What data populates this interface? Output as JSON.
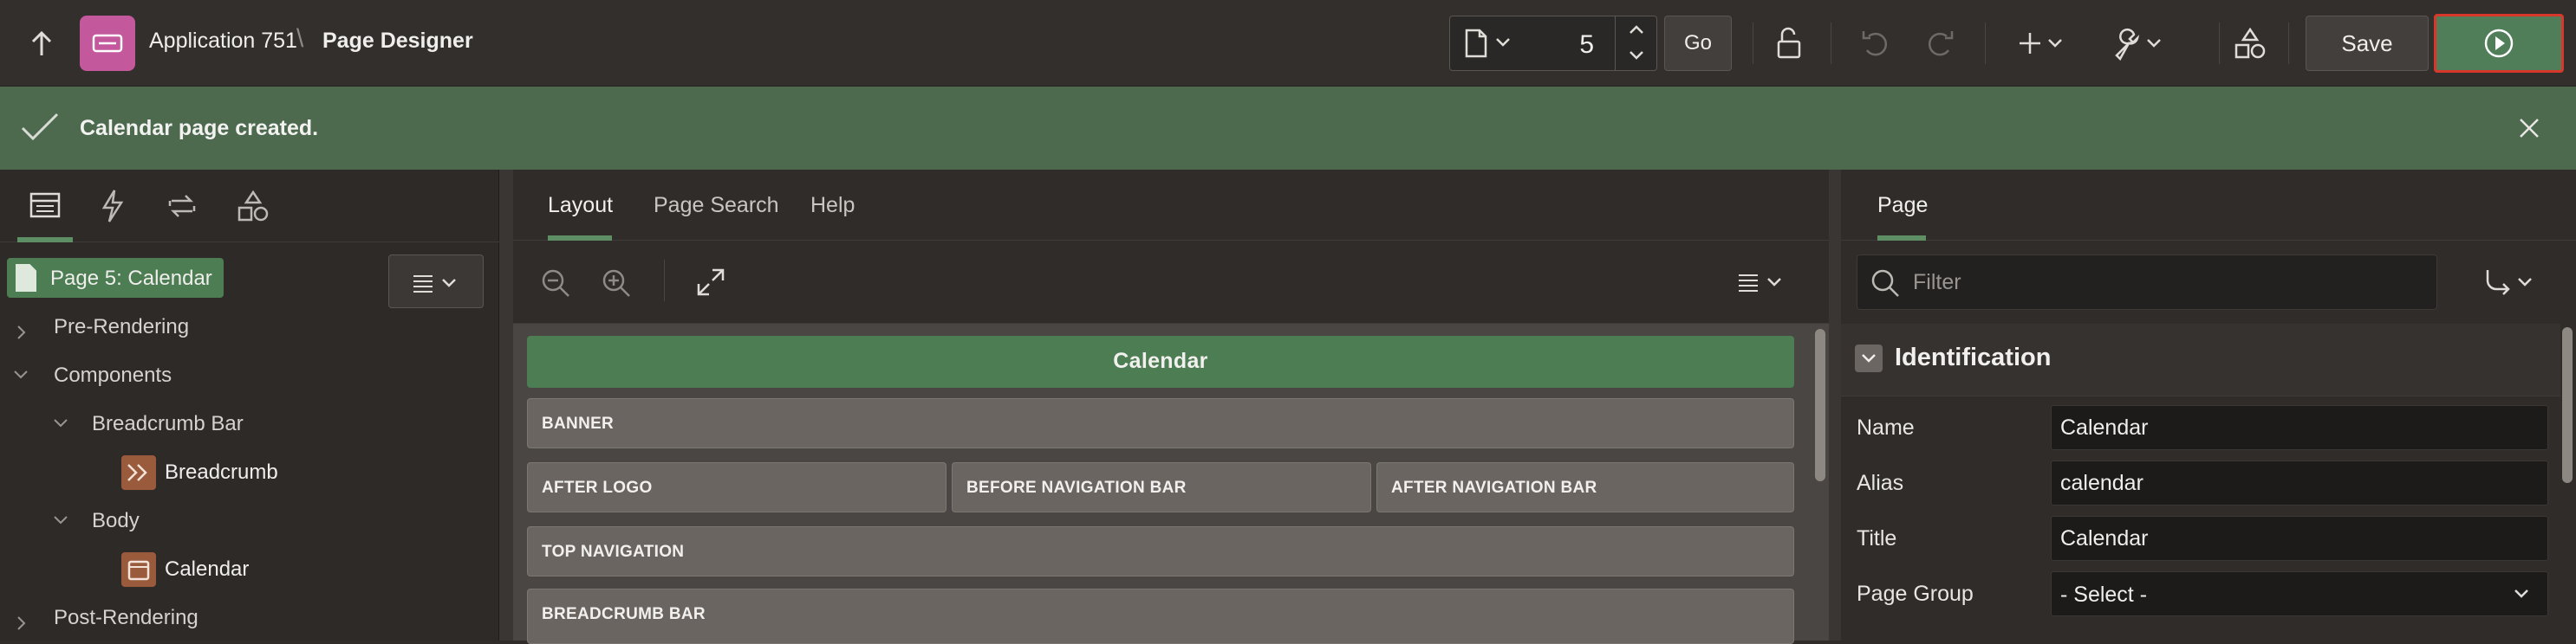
{
  "toolbar": {
    "app_name": "Application 751",
    "crumb_separator": "\\",
    "current_page": "Page Designer",
    "page_number": "5",
    "go_label": "Go",
    "save_label": "Save"
  },
  "banner": {
    "message": "Calendar page created."
  },
  "left": {
    "root_label": "Page 5: Calendar",
    "tree": [
      {
        "label": "Pre-Rendering"
      },
      {
        "label": "Components"
      },
      {
        "label": "Breadcrumb Bar"
      },
      {
        "label": "Breadcrumb"
      },
      {
        "label": "Body"
      },
      {
        "label": "Calendar"
      },
      {
        "label": "Post-Rendering"
      }
    ]
  },
  "center": {
    "tabs": [
      "Layout",
      "Page Search",
      "Help"
    ],
    "regions": [
      {
        "label": "Calendar"
      },
      {
        "label": "BANNER"
      },
      {
        "label": "AFTER LOGO"
      },
      {
        "label": "BEFORE NAVIGATION BAR"
      },
      {
        "label": "AFTER NAVIGATION BAR"
      },
      {
        "label": "TOP NAVIGATION"
      },
      {
        "label": "BREADCRUMB BAR"
      }
    ]
  },
  "right": {
    "tab": "Page",
    "filter_placeholder": "Filter",
    "section_title": "Identification",
    "props": [
      {
        "label": "Name",
        "value": "Calendar"
      },
      {
        "label": "Alias",
        "value": "calendar"
      },
      {
        "label": "Title",
        "value": "Calendar"
      },
      {
        "label": "Page Group",
        "value": "- Select -"
      }
    ]
  },
  "colors": {
    "accent_green": "#4c7d53",
    "banner_green": "#4d6a4f",
    "run_highlight": "#d8372b",
    "app_icon": "#c4589c"
  }
}
